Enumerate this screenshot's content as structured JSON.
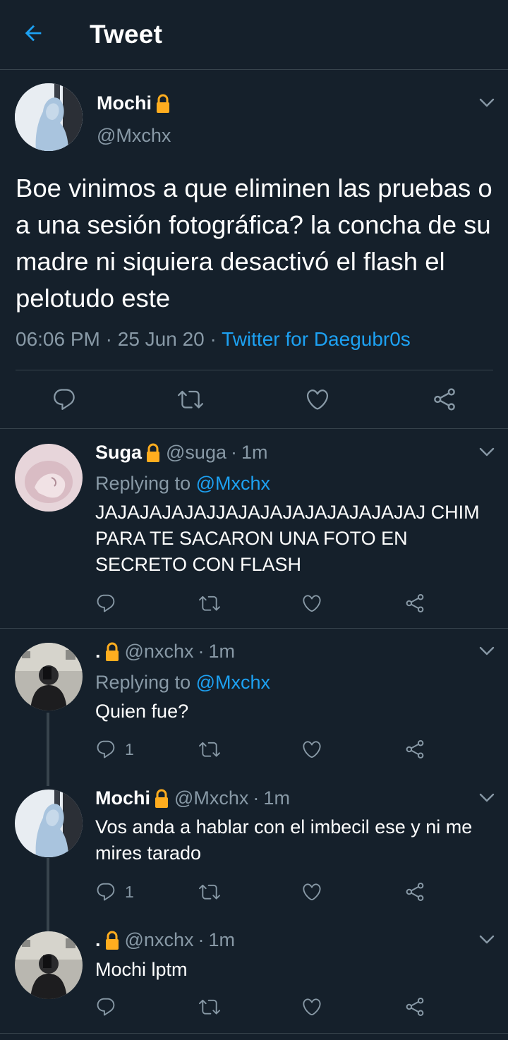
{
  "header": {
    "title": "Tweet",
    "back_icon": "arrow-left-icon",
    "accent": "#1da1f2"
  },
  "main_tweet": {
    "name": "Mochi",
    "handle": "@Mxchx",
    "text": "Boe vinimos a que eliminen las pruebas o a una sesión fotográfica? la concha de su madre ni siquiera desactivó el flash el pelotudo este",
    "time": "06:06 PM",
    "date": "25 Jun 20",
    "client": "Twitter for Daegubr0s",
    "sep": "·",
    "icons": [
      "reply-icon",
      "retweet-icon",
      "like-icon",
      "share-icon"
    ]
  },
  "replies": [
    {
      "name": "Suga",
      "handle": "@suga",
      "time": "1m",
      "replying_prefix": "Replying to",
      "replying_to": "@Mxchx",
      "text": "JAJAJAJAJAJJAJAJAJAJAJAJAJAJAJ CHIM PARA TE SACARON UNA FOTO EN SECRETO CON FLASH",
      "reply_count": ""
    },
    {
      "name": ".",
      "handle": "@nxchx",
      "time": "1m",
      "replying_prefix": "Replying to",
      "replying_to": "@Mxchx",
      "text": "Quien fue?",
      "reply_count": "1"
    },
    {
      "name": "Mochi",
      "handle": "@Mxchx",
      "time": "1m",
      "text": "Vos anda a hablar con el imbecil ese y ni me mires tarado",
      "reply_count": "1"
    },
    {
      "name": ".",
      "handle": "@nxchx",
      "time": "1m",
      "text": "Mochi lptm",
      "reply_count": ""
    }
  ],
  "colors": {
    "background": "#15202b",
    "divider": "#38444d",
    "secondary_text": "#8899a6",
    "link": "#1da1f2",
    "lock": "#ffad1f"
  }
}
